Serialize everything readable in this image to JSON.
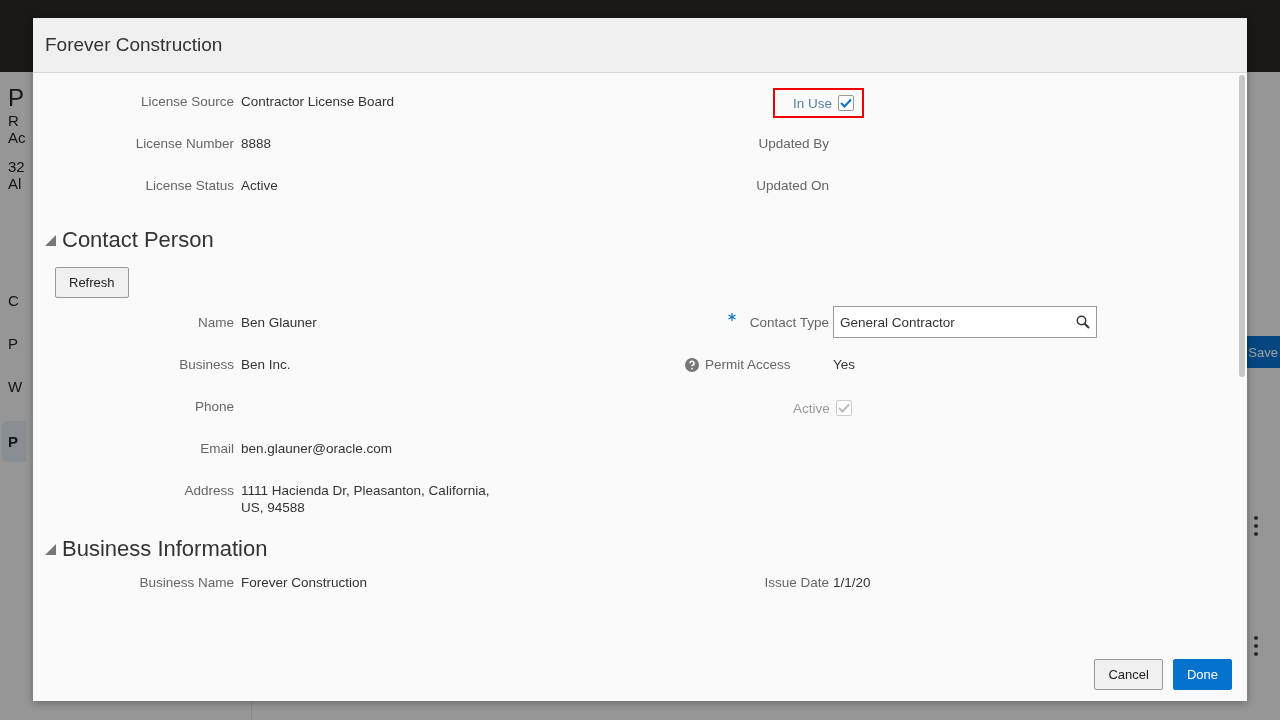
{
  "background": {
    "sidebar_texts": [
      {
        "text": "P",
        "kind": "title"
      },
      {
        "text": "R",
        "kind": "subtitle"
      },
      {
        "text": "Ac",
        "kind": "plain"
      },
      {
        "text": "32",
        "kind": "gap"
      },
      {
        "text": "Al",
        "kind": "plain"
      },
      {
        "text": "C",
        "kind": "nav"
      },
      {
        "text": "P",
        "kind": "nav"
      },
      {
        "text": "W",
        "kind": "nav"
      },
      {
        "text": "P",
        "kind": "nav-selected"
      }
    ],
    "save_button": "Save"
  },
  "dialog": {
    "title": "Forever Construction",
    "license": {
      "left": [
        {
          "label": "License Source",
          "value": "Contractor License Board",
          "kind": "text"
        },
        {
          "label": "License Number",
          "value": "8888",
          "kind": "text"
        },
        {
          "label": "License Status",
          "value": "Active",
          "kind": "text"
        }
      ],
      "right": [
        {
          "label": "In Use",
          "kind": "checkbox",
          "checked": true,
          "disabled": false,
          "highlighted": true
        },
        {
          "label": "Updated By",
          "kind": "text"
        },
        {
          "label": "Updated On",
          "kind": "text"
        }
      ]
    },
    "sections": [
      {
        "title": "Contact Person",
        "expanded": true,
        "button": "Refresh",
        "left": [
          {
            "label": "Name",
            "value": "Ben  Glauner",
            "kind": "text"
          },
          {
            "label": "Business",
            "value": "Ben Inc.",
            "kind": "text"
          },
          {
            "label": "Phone",
            "kind": "text"
          },
          {
            "label": "Email",
            "value": "ben.glauner@oracle.com",
            "kind": "text"
          },
          {
            "label": "Address",
            "value": "1111 Hacienda Dr, Pleasanton, California, US, 94588",
            "kind": "text"
          }
        ],
        "right": [
          {
            "label": "Contact Type",
            "value": "General Contractor",
            "kind": "lookup",
            "required": true
          },
          {
            "label": "Permit Access",
            "value": "Yes",
            "kind": "text",
            "help": true
          },
          {
            "label": "Active",
            "kind": "checkbox",
            "checked": true,
            "disabled": true,
            "highlighted": false
          }
        ]
      },
      {
        "title": "Business Information",
        "expanded": true,
        "left": [
          {
            "label": "Business Name",
            "value": "Forever Construction",
            "kind": "text"
          }
        ],
        "right": [
          {
            "label": "Issue Date",
            "value": "1/1/20",
            "kind": "text"
          }
        ]
      }
    ],
    "buttons": [
      {
        "label": "Cancel",
        "kind": "secondary"
      },
      {
        "label": "Done",
        "kind": "primary"
      }
    ]
  }
}
